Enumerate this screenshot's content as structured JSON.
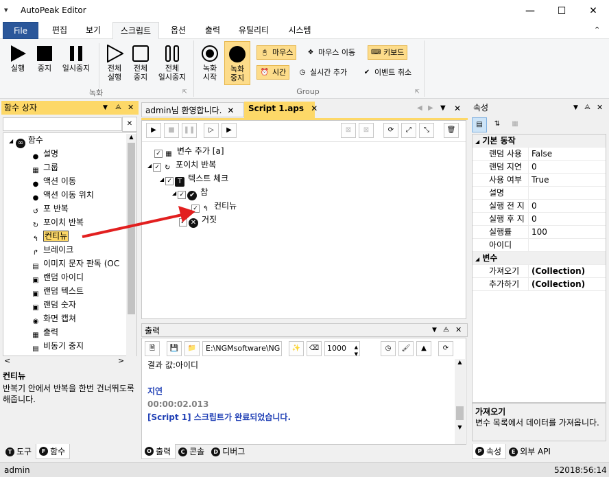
{
  "app": {
    "title": "AutoPeak Editor"
  },
  "menu": {
    "tabs": [
      "File",
      "편집",
      "보기",
      "스크립트",
      "옵션",
      "출력",
      "유틸리티",
      "시스템"
    ]
  },
  "ribbon": {
    "rec_buttons": [
      {
        "label1": "실행",
        "label2": ""
      },
      {
        "label1": "중지",
        "label2": ""
      },
      {
        "label1": "일시중지",
        "label2": ""
      },
      {
        "label1": "전체",
        "label2": "실행"
      },
      {
        "label1": "전체",
        "label2": "중지"
      },
      {
        "label1": "전체",
        "label2": "일시중지"
      }
    ],
    "group1": "녹화",
    "rec_start": {
      "l1": "녹화",
      "l2": "시작"
    },
    "rec_stop": {
      "l1": "녹화",
      "l2": "중지"
    },
    "mouse": "마우스",
    "mouse_move": "마우스 이동",
    "keyboard": "키보드",
    "time": "시간",
    "realtime": "실시간 추가",
    "event_cancel": "이벤트 취소",
    "group2": "Group"
  },
  "left": {
    "title": "함수 상자",
    "search_value": "",
    "root": "함수",
    "items": [
      "설명",
      "그룹",
      "액션 이동",
      "액션 이동 위치",
      "포 반복",
      "포이치 반복",
      "컨티뉴",
      "브레이크",
      "이미지 문자 판독 (OC",
      "랜덤 아이디",
      "랜덤 텍스트",
      "랜덤 숫자",
      "화면 캡쳐",
      "출력",
      "비동기 중지"
    ],
    "desc_title": "컨티뉴",
    "desc_text": "반복기 안에서 반복을 한번 건너뛰도록 해줍니다.",
    "tabs": [
      {
        "letter": "T",
        "label": "도구"
      },
      {
        "letter": "F",
        "label": "함수"
      }
    ]
  },
  "doc": {
    "tabs": [
      "admin님 환영합니다.",
      "Script 1.aps"
    ],
    "tree": [
      {
        "label": "변수 추가 [a]",
        "indent": 0
      },
      {
        "label": "포이치 반복",
        "indent": 0
      },
      {
        "label": "텍스트 체크",
        "indent": 1
      },
      {
        "label": "참",
        "indent": 2
      },
      {
        "label": "컨티뉴",
        "indent": 3
      },
      {
        "label": "거짓",
        "indent": 2
      }
    ]
  },
  "output": {
    "title": "출력",
    "path": "E:\\NGMsoftware\\NG",
    "number": "1000",
    "lines": [
      {
        "text": "결과 값:아이디",
        "color": "#000000"
      },
      {
        "text": "",
        "color": "#000000"
      },
      {
        "text": "지연",
        "color": "#1f3fb5"
      },
      {
        "text": "00:00:02.013",
        "color": "#808080"
      },
      {
        "text": "[Script 1] 스크립트가 완료되었습니다.",
        "color": "#1f3fb5"
      }
    ],
    "tabs": [
      {
        "letter": "O",
        "label": "출력"
      },
      {
        "letter": "C",
        "label": "콘솔"
      },
      {
        "letter": "D",
        "label": "디버그"
      }
    ]
  },
  "props": {
    "title": "속성",
    "cat1": "기본 동작",
    "rows1": [
      {
        "k": "랜덤 사용",
        "v": "False"
      },
      {
        "k": "랜덤 지연",
        "v": "0"
      },
      {
        "k": "사용 여부",
        "v": "True"
      },
      {
        "k": "설명",
        "v": ""
      },
      {
        "k": "실행 전 지",
        "v": "0"
      },
      {
        "k": "실행 후 지",
        "v": "0"
      },
      {
        "k": "실행률",
        "v": "100"
      },
      {
        "k": "아이디",
        "v": ""
      }
    ],
    "cat2": "변수",
    "rows2": [
      {
        "k": "가져오기",
        "v": "(Collection)"
      },
      {
        "k": "추가하기",
        "v": "(Collection)"
      }
    ],
    "desc_title": "가져오기",
    "desc_text": "변수 목록에서 데이터를 가져옵니다.",
    "tabs": [
      {
        "letter": "P",
        "label": "속성"
      },
      {
        "letter": "E",
        "label": "외부 API"
      }
    ]
  },
  "status": {
    "user": "admin",
    "time": "52018:56:14"
  }
}
